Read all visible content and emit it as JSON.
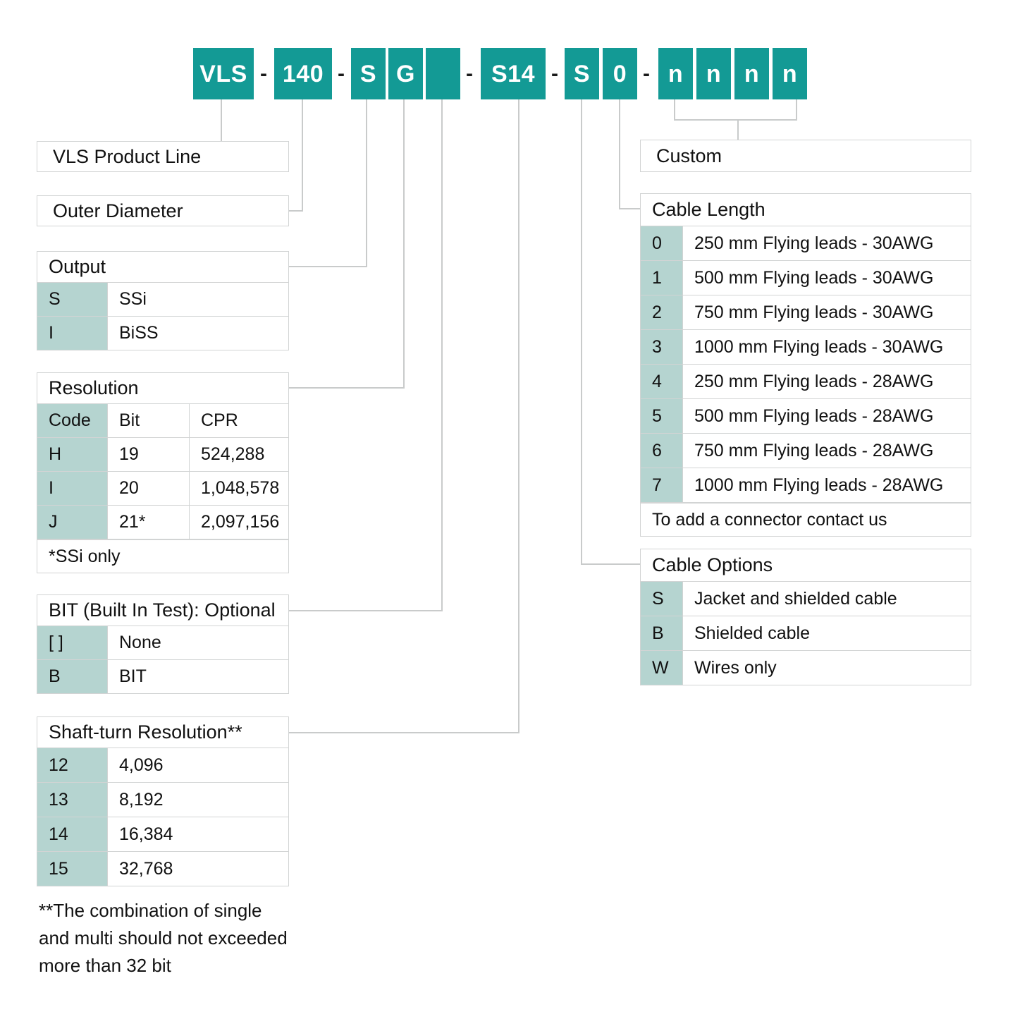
{
  "colors": {
    "teal": "#139a95",
    "sage": "#b5d4d0",
    "line": "#c9cbcb",
    "text": "#111111"
  },
  "part_number": {
    "segments": [
      {
        "label": "VLS"
      },
      {
        "label": "140"
      },
      {
        "label": "S"
      },
      {
        "label": "G"
      },
      {
        "label": ""
      },
      {
        "label": "S14"
      },
      {
        "label": "S"
      },
      {
        "label": "0"
      },
      {
        "label": "n"
      },
      {
        "label": "n"
      },
      {
        "label": "n"
      },
      {
        "label": "n"
      }
    ],
    "separator": "-"
  },
  "product_line": {
    "title": "VLS  Product Line"
  },
  "outer_diameter": {
    "title": "Outer Diameter"
  },
  "output": {
    "title": "Output",
    "rows": [
      {
        "code": "S",
        "desc": "SSi"
      },
      {
        "code": "I",
        "desc": "BiSS"
      }
    ]
  },
  "resolution": {
    "title": "Resolution",
    "headers": {
      "code": "Code",
      "bit": "Bit",
      "cpr": "CPR"
    },
    "rows": [
      {
        "code": "H",
        "bit": "19",
        "cpr": "524,288"
      },
      {
        "code": "I",
        "bit": "20",
        "cpr": "1,048,578"
      },
      {
        "code": "J",
        "bit": "21*",
        "cpr": "2,097,156"
      }
    ],
    "footnote": "*SSi only"
  },
  "bit_test": {
    "title": "BIT (Built In Test): Optional",
    "rows": [
      {
        "code": "[ ]",
        "desc": "None"
      },
      {
        "code": "B",
        "desc": "BIT"
      }
    ]
  },
  "shaft_turn": {
    "title": "Shaft-turn Resolution**",
    "rows": [
      {
        "code": "12",
        "desc": "4,096"
      },
      {
        "code": "13",
        "desc": "8,192"
      },
      {
        "code": "14",
        "desc": "16,384"
      },
      {
        "code": "15",
        "desc": "32,768"
      }
    ]
  },
  "footnote": "**The combination of single\nand multi should not exceeded\nmore than 32 bit",
  "custom": {
    "title": "Custom"
  },
  "cable_length": {
    "title": "Cable Length",
    "rows": [
      {
        "code": "0",
        "desc": "250 mm Flying leads - 30AWG"
      },
      {
        "code": "1",
        "desc": "500 mm Flying leads - 30AWG"
      },
      {
        "code": "2",
        "desc": "750 mm Flying leads - 30AWG"
      },
      {
        "code": "3",
        "desc": "1000 mm Flying leads - 30AWG"
      },
      {
        "code": "4",
        "desc": "250 mm Flying leads - 28AWG"
      },
      {
        "code": "5",
        "desc": "500 mm Flying leads - 28AWG"
      },
      {
        "code": "6",
        "desc": "750 mm Flying leads - 28AWG"
      },
      {
        "code": "7",
        "desc": "1000 mm Flying leads - 28AWG"
      }
    ],
    "footnote": "To add a connector contact us"
  },
  "cable_options": {
    "title": "Cable Options",
    "rows": [
      {
        "code": "S",
        "desc": "Jacket and shielded cable"
      },
      {
        "code": "B",
        "desc": "Shielded cable"
      },
      {
        "code": "W",
        "desc": "Wires only"
      }
    ]
  }
}
